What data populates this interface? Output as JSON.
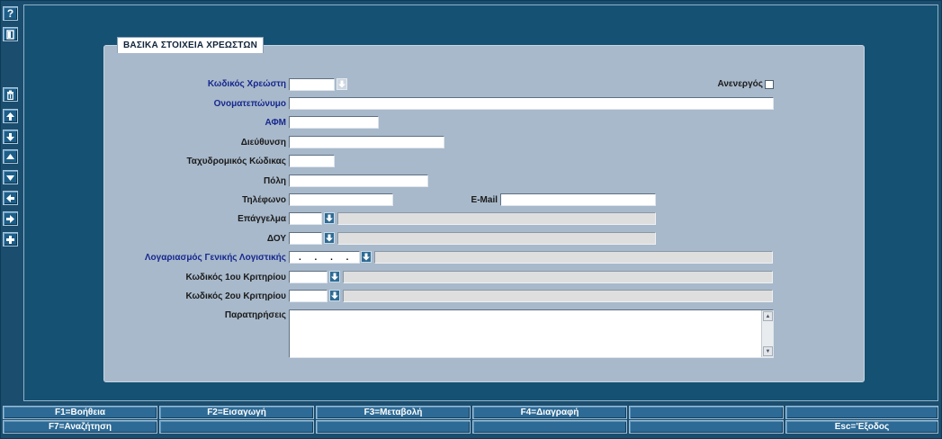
{
  "toolbar": {
    "help_glyph": "?",
    "buttons": [
      {
        "name": "help-button",
        "icon": "question-icon"
      },
      {
        "name": "exit-door-button",
        "icon": "door-icon"
      },
      {
        "name": "delete-record-button",
        "icon": "trash-icon"
      },
      {
        "name": "first-record-button",
        "icon": "arrow-top-icon"
      },
      {
        "name": "last-record-button",
        "icon": "arrow-bottom-icon"
      },
      {
        "name": "previous-record-button",
        "icon": "triangle-up-icon"
      },
      {
        "name": "next-record-button",
        "icon": "triangle-down-icon"
      },
      {
        "name": "previous-block-button",
        "icon": "arrow-left-icon"
      },
      {
        "name": "next-block-button",
        "icon": "arrow-right-icon"
      },
      {
        "name": "new-record-button",
        "icon": "plus-icon"
      }
    ]
  },
  "form": {
    "tab_title": "ΒΑΣΙΚΑ ΣΤΟΙΧΕΙΑ ΧΡΕΩΣΤΩΝ",
    "labels": {
      "debtor_code": "Κωδικός Χρεώστη",
      "inactive": "Ανενεργός",
      "full_name": "Ονοματεπώνυμο",
      "afm": "ΑΦΜ",
      "address": "Διεύθυνση",
      "postal_code": "Ταχυδρομικός Κώδικας",
      "city": "Πόλη",
      "phone": "Τηλέφωνο",
      "email": "E-Mail",
      "profession": "Επάγγελμα",
      "tax_office": "ΔΟΥ",
      "gl_account": "Λογαριασμός Γενικής Λογιστικής",
      "criterion1": "Κωδικός 1ου Κριτηρίου",
      "criterion2": "Κωδικός 2ου Κριτηρίου",
      "notes": "Παρατηρήσεις"
    },
    "values": {
      "debtor_code": "",
      "inactive": false,
      "full_name": "",
      "afm": "",
      "address": "",
      "postal_code": "",
      "city": "",
      "phone": "",
      "email": "",
      "profession_code": "",
      "profession_desc": "",
      "tax_office_code": "",
      "tax_office_desc": "",
      "gl_account_mask": ". . . .",
      "gl_account_desc": "",
      "criterion1_code": "",
      "criterion1_desc": "",
      "criterion2_code": "",
      "criterion2_desc": "",
      "notes": ""
    }
  },
  "function_keys": {
    "row1": [
      "F1=Βοήθεια",
      "F2=Εισαγωγή",
      "F3=Μεταβολή",
      "F4=Διαγραφή",
      "",
      ""
    ],
    "row2": [
      "F7=Αναζήτηση",
      "",
      "",
      "",
      "",
      "Esc='Εξοδος"
    ]
  },
  "colors": {
    "background": "#1b4d6e",
    "panel": "#a8b9cb",
    "required_label": "#17288f",
    "button": "#2d6a95"
  }
}
